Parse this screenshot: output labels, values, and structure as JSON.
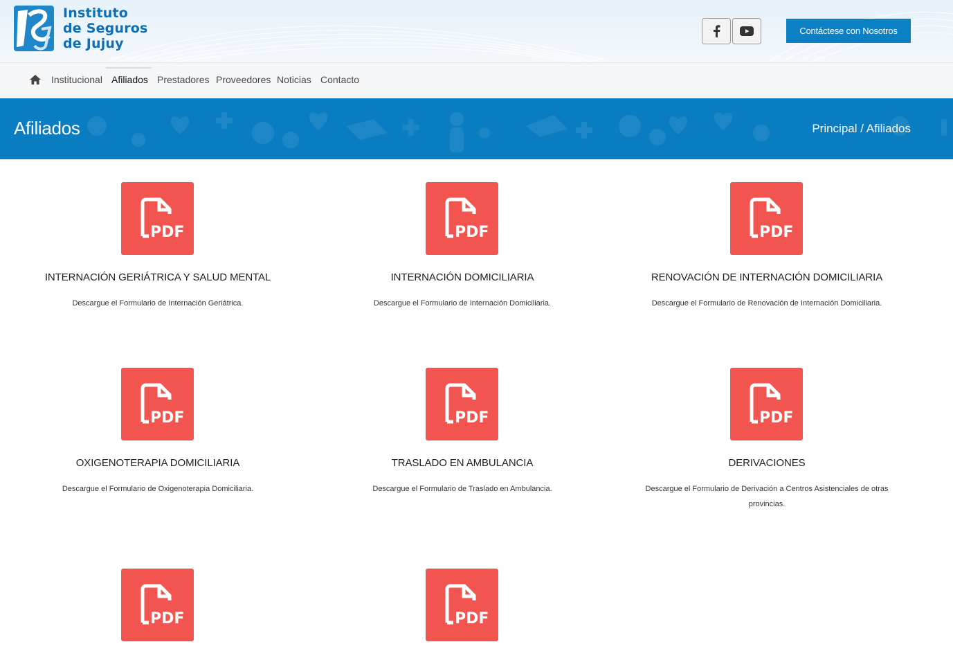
{
  "logo": {
    "line1": "Instituto",
    "line2": "de Seguros",
    "line3": "de Jujuy",
    "mark_text": "ISJ"
  },
  "header": {
    "social": [
      {
        "name": "facebook",
        "icon": "facebook-icon"
      },
      {
        "name": "youtube",
        "icon": "youtube-icon"
      }
    ],
    "contact_button": "Contáctese con Nosotros"
  },
  "nav": {
    "items": [
      {
        "label": "Institucional"
      },
      {
        "label": "Afiliados"
      },
      {
        "label": "Prestadores"
      },
      {
        "label": "Proveedores"
      },
      {
        "label": "Noticias"
      },
      {
        "label": "Contacto"
      }
    ],
    "active": "Afiliados"
  },
  "banner": {
    "title": "Afiliados",
    "breadcrumb": "Principal / Afiliados"
  },
  "cards": [
    {
      "title": "INTERNACIÓN GERIÁTRICA Y SALUD MENTAL",
      "desc": "Descargue el Formulario de Internación Geriátrica."
    },
    {
      "title": "INTERNACIÓN DOMICILIARIA",
      "desc": "Descargue el Formulario de Internación Domiciliaria."
    },
    {
      "title": "RENOVACIÓN DE INTERNACIÓN DOMICILIARIA",
      "desc": "Descargue el Formulario de Renovación de Internación Domiciliaria."
    },
    {
      "title": "OXIGENOTERAPIA DOMICILIARIA",
      "desc": "Descargue el Formulario de Oxigenoterapia Domiciliaria."
    },
    {
      "title": "TRASLADO EN AMBULANCIA",
      "desc": "Descargue el Formulario de Traslado en Ambulancia."
    },
    {
      "title": "DERIVACIONES",
      "desc_line1": "Descargue el Formulario de Derivación a Centros Asistenciales de otras",
      "desc_line2": "provincias."
    }
  ],
  "pdf_icon_label": "PDF",
  "colors": {
    "brand_blue": "#0b80c5",
    "banner_blue": "#0a7dc2",
    "pdf_red": "#f2544f",
    "logo_blue": "#0d6fb5"
  }
}
